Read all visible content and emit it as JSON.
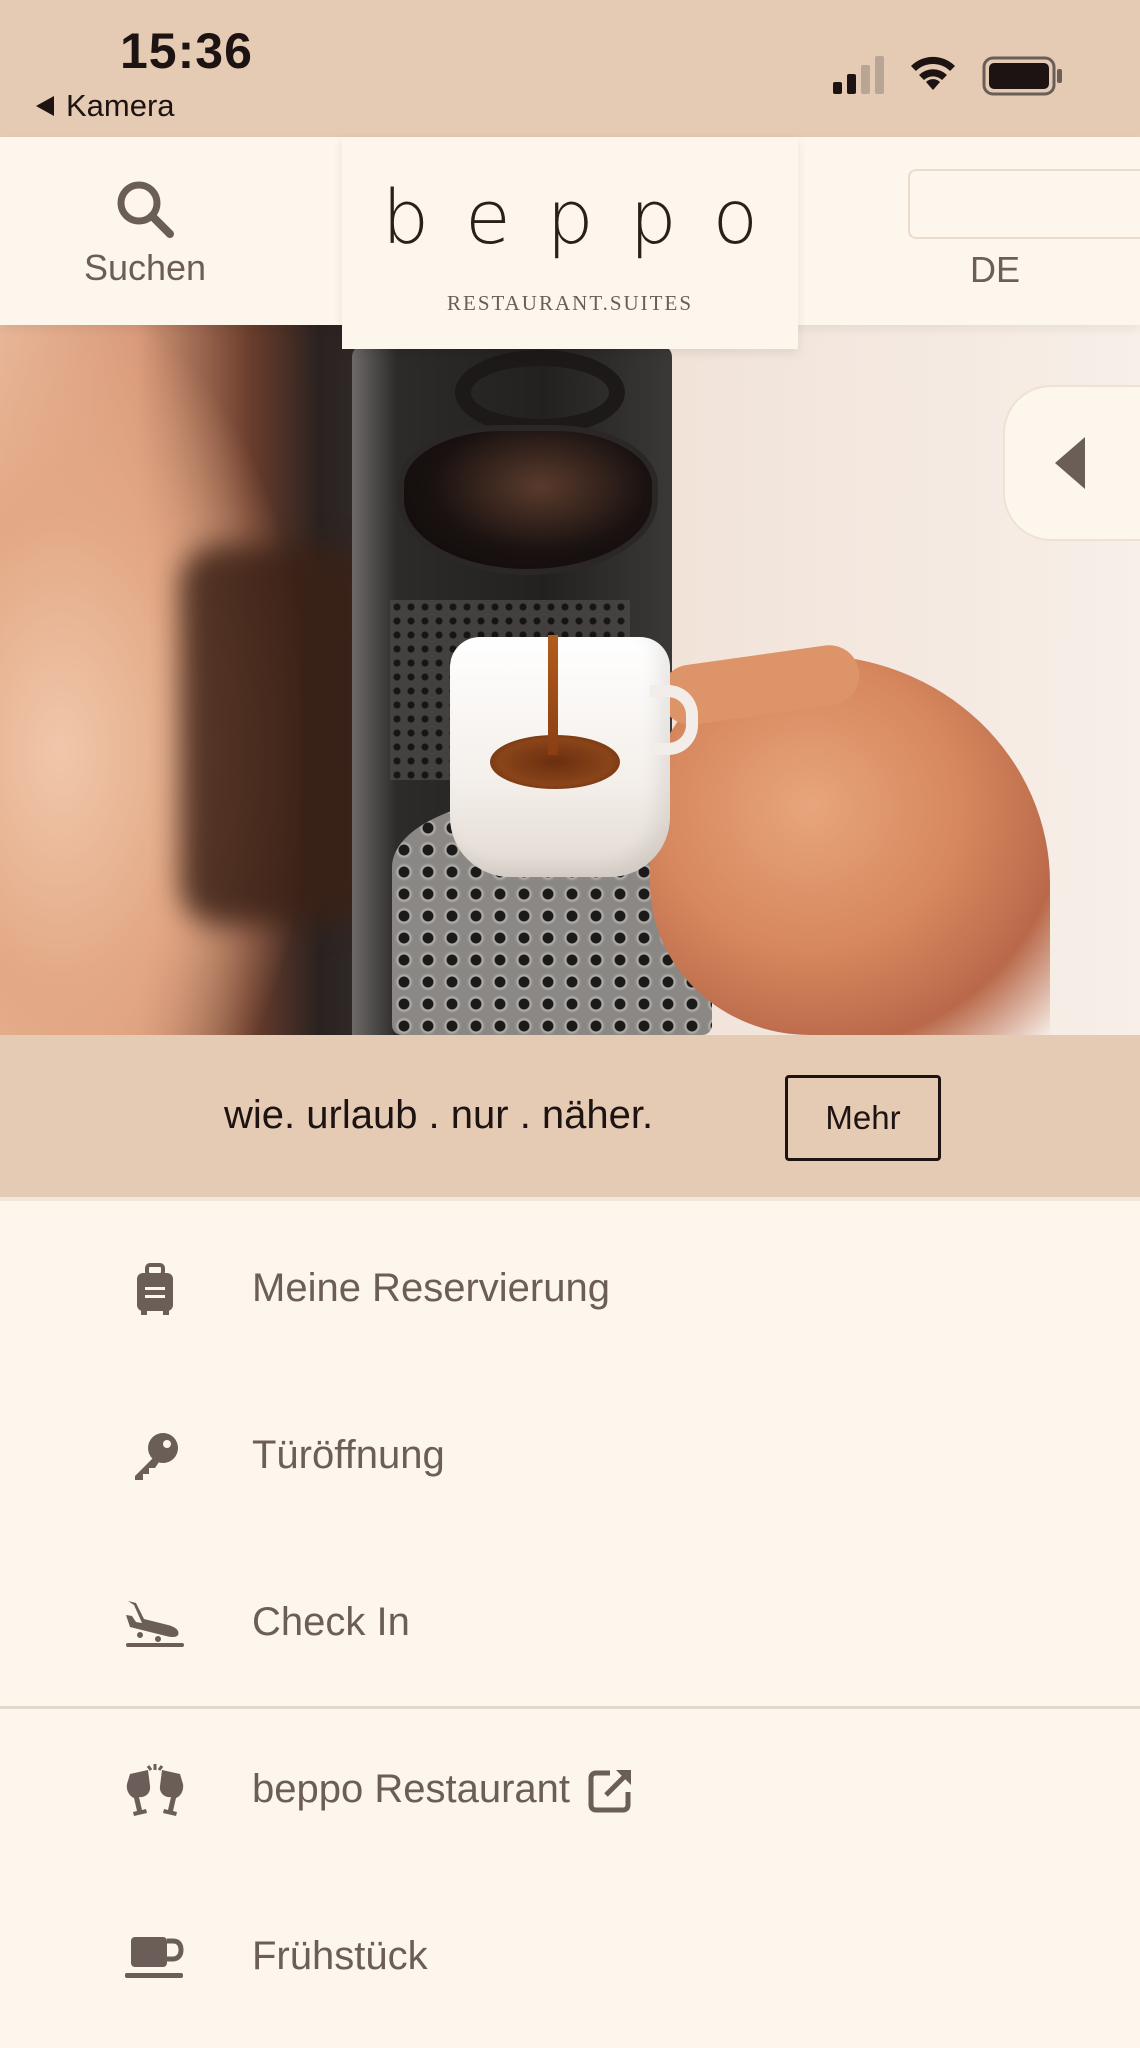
{
  "status_bar": {
    "time": "15:36",
    "back_label": "Kamera",
    "icons": [
      "cellular-signal-icon",
      "wifi-icon",
      "battery-icon"
    ]
  },
  "header": {
    "search_label": "Suchen",
    "logo_word": "beppo",
    "logo_sub": "RESTAURANT.SUITES",
    "language": "DE"
  },
  "hero": {
    "image_icon": "coffee-machine-photo"
  },
  "slogan": {
    "text": "wie. urlaub . nur . näher.",
    "button_label": "Mehr"
  },
  "menu": {
    "items": [
      {
        "label": "Meine Reservierung",
        "icon": "suitcase-icon"
      },
      {
        "label": "Türöffnung",
        "icon": "key-icon"
      },
      {
        "label": "Check In",
        "icon": "plane-landing-icon"
      },
      {
        "label": "beppo Restaurant",
        "icon": "glasses-cheers-icon",
        "external": true
      },
      {
        "label": "Frühstück",
        "icon": "coffee-mug-icon"
      }
    ]
  },
  "colors": {
    "accent": "#e6cbb4",
    "background": "#fdf6ec",
    "text": "#6b5d57",
    "dark": "#1d1313"
  }
}
